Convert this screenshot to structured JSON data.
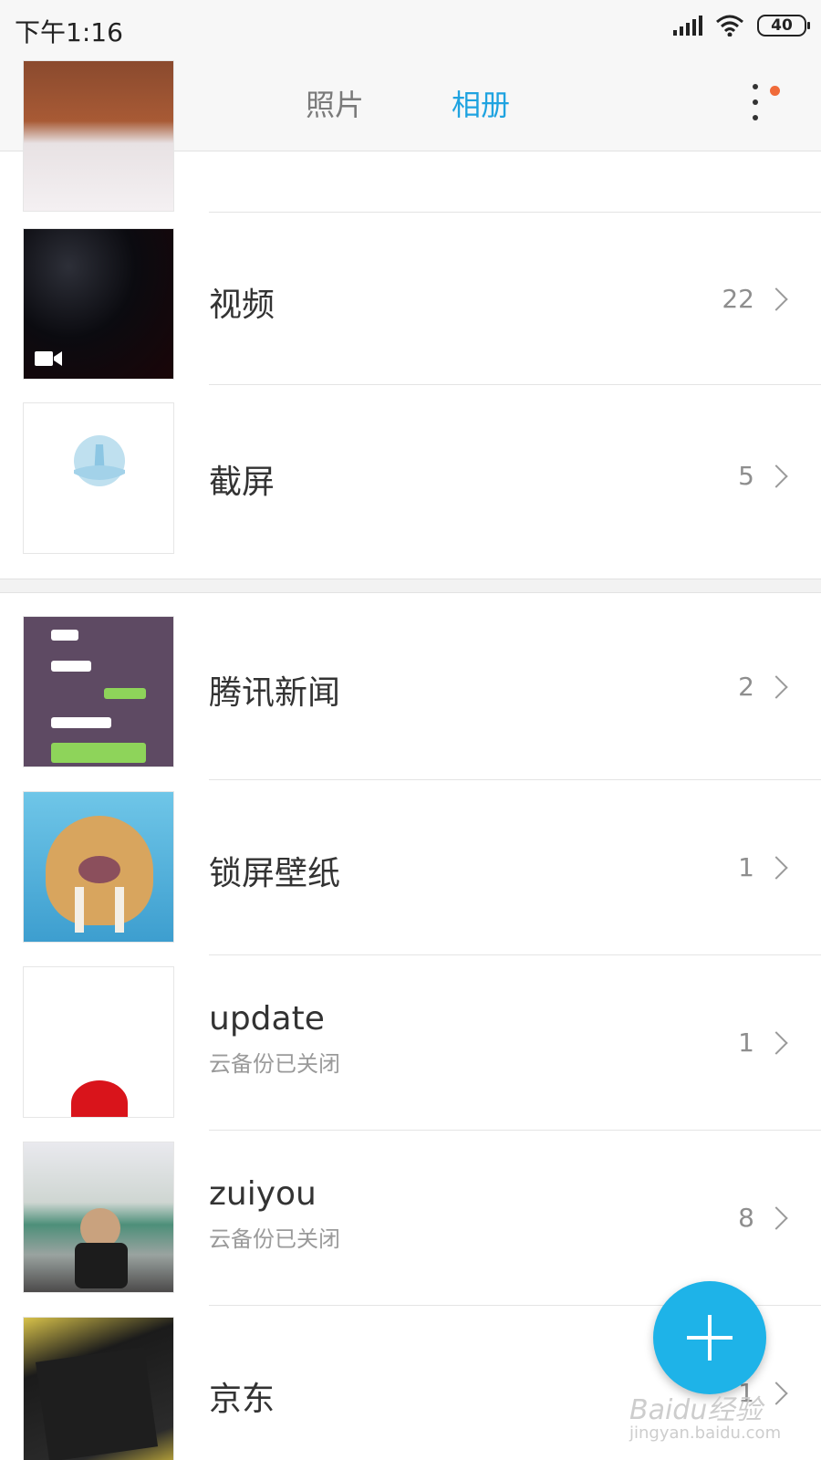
{
  "status_bar": {
    "time": "下午1:16",
    "battery": "40",
    "signal_icon": "signal-icon",
    "wifi_icon": "wifi-icon"
  },
  "tabs": [
    {
      "label": "照片",
      "active": false
    },
    {
      "label": "相册",
      "active": true
    }
  ],
  "colors": {
    "accent": "#1fa3e0",
    "fab": "#1eb3e8",
    "notification_dot": "#f06b3a"
  },
  "albums": [
    {
      "title": "视频",
      "count": "22",
      "subtitle": ""
    },
    {
      "title": "截屏",
      "count": "5",
      "subtitle": ""
    },
    {
      "title": "腾讯新闻",
      "count": "2",
      "subtitle": ""
    },
    {
      "title": "锁屏壁纸",
      "count": "1",
      "subtitle": ""
    },
    {
      "title": "update",
      "count": "1",
      "subtitle": "云备份已关闭"
    },
    {
      "title": "zuiyou",
      "count": "8",
      "subtitle": "云备份已关闭"
    },
    {
      "title": "京东",
      "count": "1",
      "subtitle": ""
    }
  ],
  "watermark": {
    "brand": "Baidu经验",
    "url": "jingyan.baidu.com"
  }
}
